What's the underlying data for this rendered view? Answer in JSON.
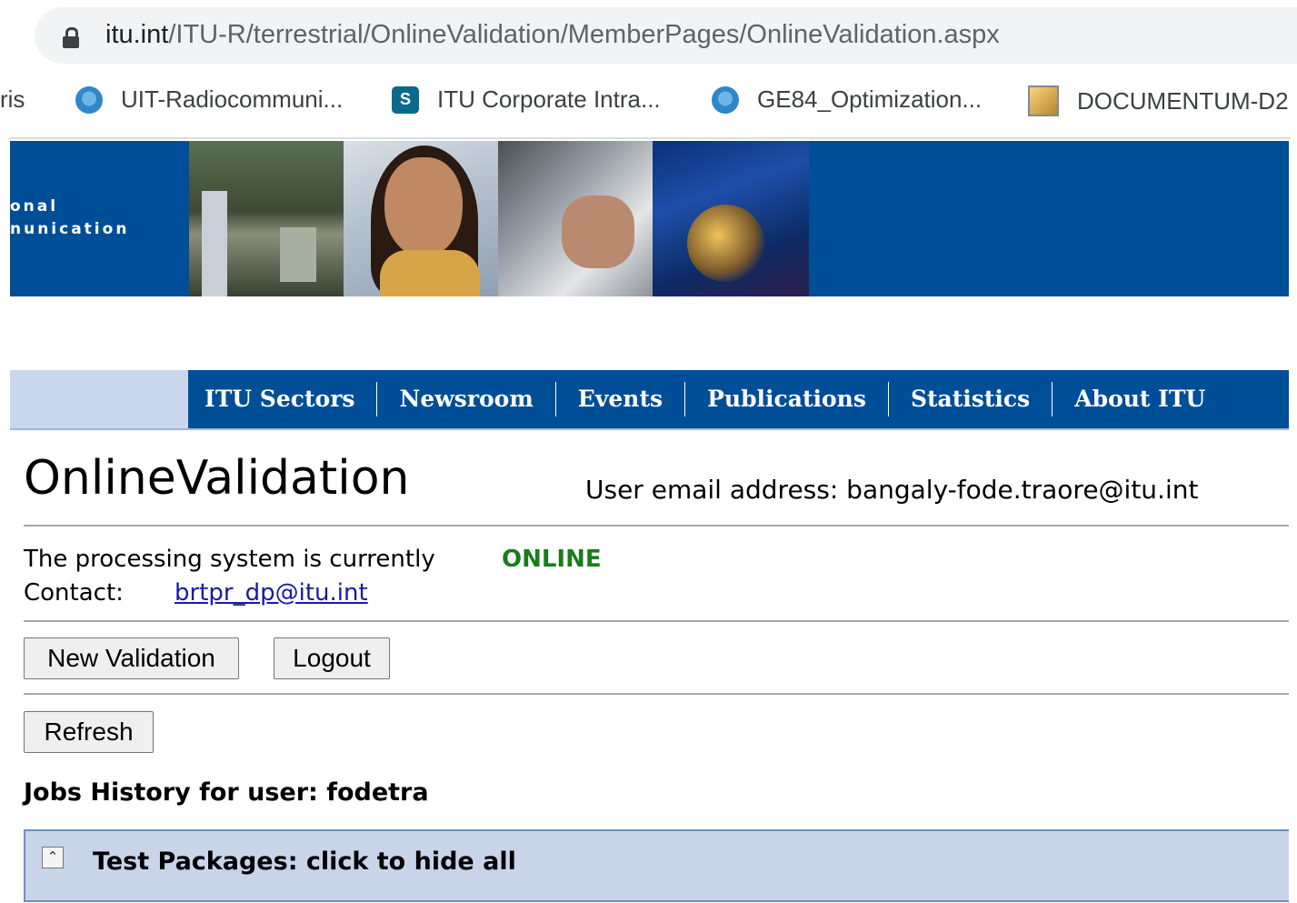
{
  "browser": {
    "url_domain": "itu.int",
    "url_path": "/ITU-R/terrestrial/OnlineValidation/MemberPages/OnlineValidation.aspx",
    "bookmarks": [
      {
        "label": "ris"
      },
      {
        "label": "UIT-Radiocommuni..."
      },
      {
        "label": "ITU Corporate Intra..."
      },
      {
        "label": "GE84_Optimization..."
      },
      {
        "label": "DOCUMENTUM-D2"
      }
    ]
  },
  "banner": {
    "text_line1": "onal",
    "text_line2": "nunication"
  },
  "nav": {
    "items": [
      "ITU Sectors",
      "Newsroom",
      "Events",
      "Publications",
      "Statistics",
      "About ITU"
    ]
  },
  "page": {
    "title": "OnlineValidation",
    "user_email": "User email address: bangaly-fode.traore@itu.int",
    "status_text": "The processing system is currently",
    "status_value": "ONLINE",
    "status_color": "#1a7d1a",
    "contact_label": "Contact:",
    "contact_email": "brtpr_dp@itu.int",
    "buttons": {
      "new_validation": "New Validation",
      "logout": "Logout",
      "refresh": "Refresh"
    },
    "jobs_title": "Jobs History for user: fodetra",
    "packages_label": "Test Packages: click to hide all",
    "packages_icon": "double-chevron-up-icon"
  },
  "colors": {
    "banner_blue": "#004e98",
    "nav_light": "#c8d7ee",
    "packages_bg": "#c8d4e8"
  }
}
